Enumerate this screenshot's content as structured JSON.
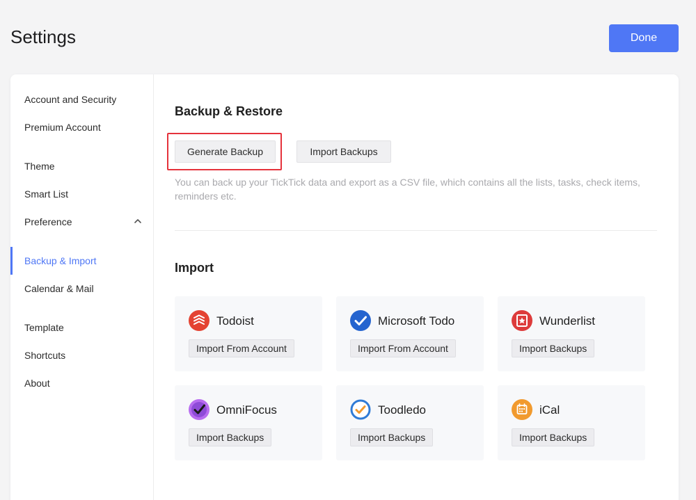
{
  "header": {
    "title": "Settings",
    "done_label": "Done"
  },
  "sidebar": {
    "items": [
      {
        "label": "Account and Security"
      },
      {
        "label": "Premium Account"
      },
      {
        "label": "Theme"
      },
      {
        "label": "Smart List"
      },
      {
        "label": "Preference"
      },
      {
        "label": "Backup & Import",
        "active": true
      },
      {
        "label": "Calendar & Mail"
      },
      {
        "label": "Template"
      },
      {
        "label": "Shortcuts"
      },
      {
        "label": "About"
      }
    ]
  },
  "backup": {
    "title": "Backup & Restore",
    "generate_label": "Generate Backup",
    "import_label": "Import Backups",
    "description": "You can back up your TickTick data and export as a CSV file, which contains all the lists, tasks, check items, reminders etc."
  },
  "import": {
    "title": "Import",
    "cards": [
      {
        "name": "Todoist",
        "button": "Import From Account",
        "icon": "todoist-icon",
        "color": "#e44332"
      },
      {
        "name": "Microsoft Todo",
        "button": "Import From Account",
        "icon": "microsoft-todo-icon",
        "color": "#2564cf"
      },
      {
        "name": "Wunderlist",
        "button": "Import Backups",
        "icon": "wunderlist-icon",
        "color": "#dd3b3b"
      },
      {
        "name": "OmniFocus",
        "button": "Import Backups",
        "icon": "omnifocus-icon",
        "color": "#8e4bd8"
      },
      {
        "name": "Toodledo",
        "button": "Import Backups",
        "icon": "toodledo-icon",
        "color": "#2f7bd6"
      },
      {
        "name": "iCal",
        "button": "Import Backups",
        "icon": "ical-icon",
        "color": "#f19a2e"
      }
    ]
  },
  "colors": {
    "accent": "#4f77f5",
    "highlight": "#e5323b"
  }
}
